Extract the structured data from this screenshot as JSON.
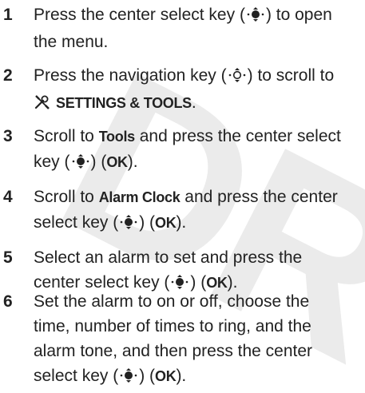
{
  "watermark": "DR",
  "steps": [
    {
      "number": "1",
      "line1_a": "Press the center select key (",
      "line1_b": ") to open",
      "line2": "the menu."
    },
    {
      "number": "2",
      "line1_a": "Press the navigation key (",
      "line1_b": ") to scroll to",
      "line2_b": "SETTINGS & TOOLS",
      "line2_c": "."
    },
    {
      "number": "3",
      "line1_a": "Scroll to ",
      "line1_b": "Tools",
      "line1_c": " and press the center select",
      "line2_a": "key (",
      "line2_b": ") (",
      "line2_c": "OK",
      "line2_d": ")."
    },
    {
      "number": "4",
      "line1_a": "Scroll to ",
      "line1_b": "Alarm Clock",
      "line1_c": " and press the center",
      "line2_a": "select key (",
      "line2_b": ") (",
      "line2_c": "OK",
      "line2_d": ")."
    },
    {
      "number": "5",
      "line1": "Select an alarm to set and press the",
      "line2_a": "center select key (",
      "line2_b": ") (",
      "line2_c": "OK",
      "line2_d": ")."
    },
    {
      "number": "6",
      "line1": "Set the alarm to on or off, choose the",
      "line2": "time, number of times to ring, and the",
      "line3": "alarm tone, and then press the center",
      "line4_a": "select key (",
      "line4_b": ") (",
      "line4_c": "OK",
      "line4_d": ")."
    }
  ],
  "icons": {
    "center_select": "center-select-key-icon",
    "navigation": "navigation-key-icon",
    "tools": "settings-tools-icon"
  }
}
